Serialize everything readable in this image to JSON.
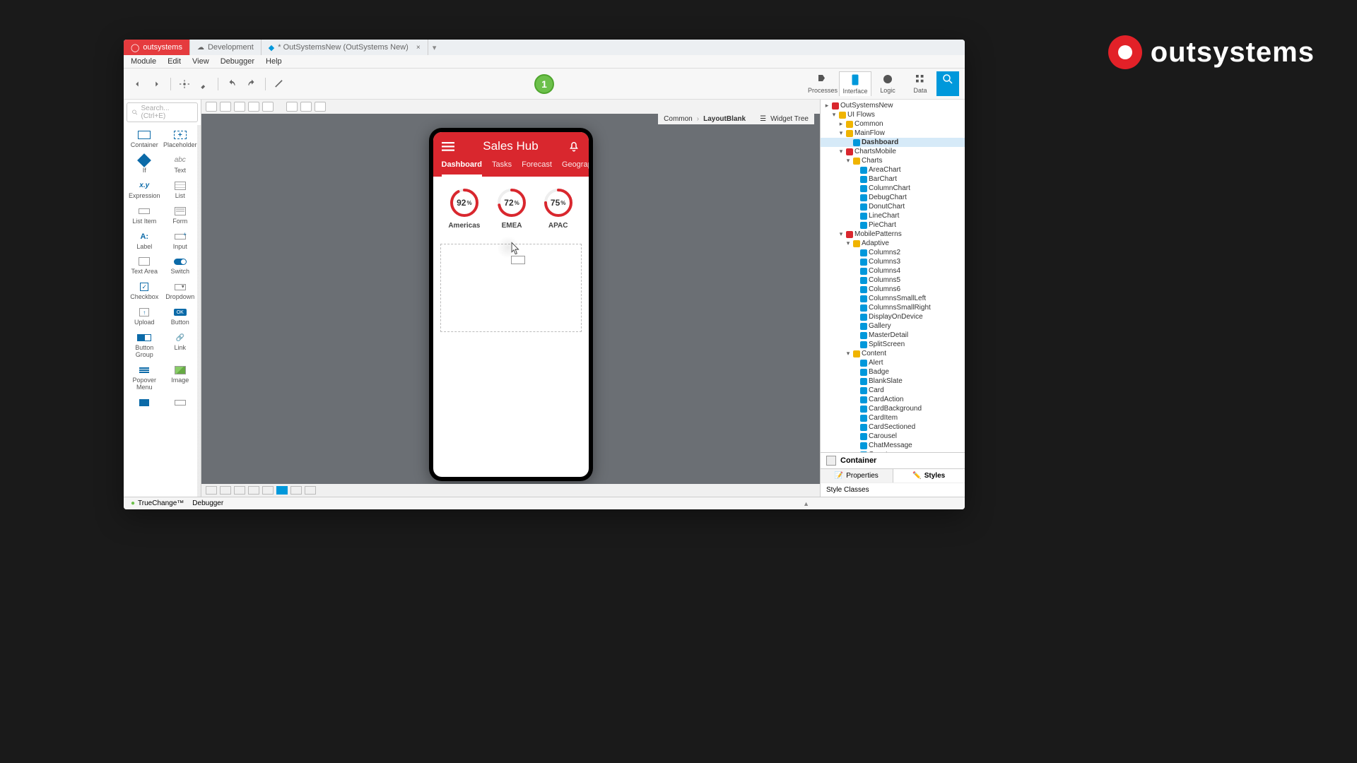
{
  "brand": "outsystems",
  "tabs": {
    "app": "outsystems",
    "env": "Development",
    "module": "* OutSystemsNew (OutSystems New)"
  },
  "menu": {
    "module": "Module",
    "edit": "Edit",
    "view": "View",
    "debugger": "Debugger",
    "help": "Help"
  },
  "publish_badge": "1",
  "right_tools": {
    "processes": "Processes",
    "interface": "Interface",
    "logic": "Logic",
    "data": "Data"
  },
  "search_placeholder": "Search... (Ctrl+E)",
  "widgets": [
    {
      "id": "container",
      "label": "Container",
      "cls": "ico-container"
    },
    {
      "id": "placeholder",
      "label": "Placeholder",
      "cls": "ico-placeholder",
      "inner": "+"
    },
    {
      "id": "if",
      "label": "If",
      "cls": "ico-if"
    },
    {
      "id": "text",
      "label": "Text",
      "cls": "ico-text",
      "inner": "abc"
    },
    {
      "id": "expression",
      "label": "Expression",
      "cls": "ico-expr",
      "inner": "x.y"
    },
    {
      "id": "list",
      "label": "List",
      "cls": "ico-list"
    },
    {
      "id": "listitem",
      "label": "List Item",
      "cls": "ico-listitem"
    },
    {
      "id": "form",
      "label": "Form",
      "cls": "ico-form"
    },
    {
      "id": "label",
      "label": "Label",
      "cls": "ico-label",
      "inner": "A:"
    },
    {
      "id": "input",
      "label": "Input",
      "cls": "ico-input"
    },
    {
      "id": "textarea",
      "label": "Text Area",
      "cls": "ico-textarea"
    },
    {
      "id": "switch",
      "label": "Switch",
      "cls": "ico-switch"
    },
    {
      "id": "checkbox",
      "label": "Checkbox",
      "cls": "ico-checkbox",
      "inner": "✓"
    },
    {
      "id": "dropdown",
      "label": "Dropdown",
      "cls": "ico-dropdown"
    },
    {
      "id": "upload",
      "label": "Upload",
      "cls": "ico-upload",
      "inner": "↑"
    },
    {
      "id": "button",
      "label": "Button",
      "cls": "ico-button",
      "inner": "OK"
    },
    {
      "id": "buttongroup",
      "label": "Button Group",
      "cls": "ico-buttongroup",
      "inner": "<span></span><span></span>"
    },
    {
      "id": "link",
      "label": "Link",
      "cls": "ico-link",
      "inner": "🔗"
    },
    {
      "id": "popovermenu",
      "label": "Popover Menu",
      "cls": "ico-menu",
      "inner": "<span></span><span></span><span></span>"
    },
    {
      "id": "image",
      "label": "Image",
      "cls": "ico-image"
    },
    {
      "id": "flag",
      "label": "",
      "cls": "ico-flag"
    },
    {
      "id": "blank",
      "label": "",
      "cls": "ico-listitem"
    }
  ],
  "breadcrumb": {
    "a": "Common",
    "b": "LayoutBlank"
  },
  "widgettree_label": "Widget Tree",
  "phone": {
    "title": "Sales Hub",
    "tabs": [
      "Dashboard",
      "Tasks",
      "Forecast",
      "Geographies"
    ],
    "gauges": [
      {
        "value": 92,
        "label": "Americas"
      },
      {
        "value": 72,
        "label": "EMEA"
      },
      {
        "value": 75,
        "label": "APAC"
      }
    ]
  },
  "tree": [
    {
      "l": "OutSystemsNew",
      "exp": "▸",
      "ic": "#d9272e",
      "ind": 0
    },
    {
      "l": "UI Flows",
      "exp": "▾",
      "ic": "#f0b400",
      "ind": 1
    },
    {
      "l": "Common",
      "exp": "▸",
      "ic": "#f0b400",
      "ind": 2
    },
    {
      "l": "MainFlow",
      "exp": "▾",
      "ic": "#f0b400",
      "ind": 2
    },
    {
      "l": "Dashboard",
      "exp": "",
      "ic": "#0098db",
      "ind": 3,
      "sel": true
    },
    {
      "l": "ChartsMobile",
      "exp": "▾",
      "ic": "#d9272e",
      "ind": 2
    },
    {
      "l": "Charts",
      "exp": "▾",
      "ic": "#f0b400",
      "ind": 3
    },
    {
      "l": "AreaChart",
      "exp": "",
      "ic": "#0098db",
      "ind": 4
    },
    {
      "l": "BarChart",
      "exp": "",
      "ic": "#0098db",
      "ind": 4
    },
    {
      "l": "ColumnChart",
      "exp": "",
      "ic": "#0098db",
      "ind": 4
    },
    {
      "l": "DebugChart",
      "exp": "",
      "ic": "#0098db",
      "ind": 4
    },
    {
      "l": "DonutChart",
      "exp": "",
      "ic": "#0098db",
      "ind": 4
    },
    {
      "l": "LineChart",
      "exp": "",
      "ic": "#0098db",
      "ind": 4
    },
    {
      "l": "PieChart",
      "exp": "",
      "ic": "#0098db",
      "ind": 4
    },
    {
      "l": "MobilePatterns",
      "exp": "▾",
      "ic": "#d9272e",
      "ind": 2
    },
    {
      "l": "Adaptive",
      "exp": "▾",
      "ic": "#f0b400",
      "ind": 3
    },
    {
      "l": "Columns2",
      "exp": "",
      "ic": "#0098db",
      "ind": 4
    },
    {
      "l": "Columns3",
      "exp": "",
      "ic": "#0098db",
      "ind": 4
    },
    {
      "l": "Columns4",
      "exp": "",
      "ic": "#0098db",
      "ind": 4
    },
    {
      "l": "Columns5",
      "exp": "",
      "ic": "#0098db",
      "ind": 4
    },
    {
      "l": "Columns6",
      "exp": "",
      "ic": "#0098db",
      "ind": 4
    },
    {
      "l": "ColumnsSmallLeft",
      "exp": "",
      "ic": "#0098db",
      "ind": 4
    },
    {
      "l": "ColumnsSmallRight",
      "exp": "",
      "ic": "#0098db",
      "ind": 4
    },
    {
      "l": "DisplayOnDevice",
      "exp": "",
      "ic": "#0098db",
      "ind": 4
    },
    {
      "l": "Gallery",
      "exp": "",
      "ic": "#0098db",
      "ind": 4
    },
    {
      "l": "MasterDetail",
      "exp": "",
      "ic": "#0098db",
      "ind": 4
    },
    {
      "l": "SplitScreen",
      "exp": "",
      "ic": "#0098db",
      "ind": 4
    },
    {
      "l": "Content",
      "exp": "▾",
      "ic": "#f0b400",
      "ind": 3
    },
    {
      "l": "Alert",
      "exp": "",
      "ic": "#0098db",
      "ind": 4
    },
    {
      "l": "Badge",
      "exp": "",
      "ic": "#0098db",
      "ind": 4
    },
    {
      "l": "BlankSlate",
      "exp": "",
      "ic": "#0098db",
      "ind": 4
    },
    {
      "l": "Card",
      "exp": "",
      "ic": "#0098db",
      "ind": 4
    },
    {
      "l": "CardAction",
      "exp": "",
      "ic": "#0098db",
      "ind": 4
    },
    {
      "l": "CardBackground",
      "exp": "",
      "ic": "#0098db",
      "ind": 4
    },
    {
      "l": "CardItem",
      "exp": "",
      "ic": "#0098db",
      "ind": 4
    },
    {
      "l": "CardSectioned",
      "exp": "",
      "ic": "#0098db",
      "ind": 4
    },
    {
      "l": "Carousel",
      "exp": "",
      "ic": "#0098db",
      "ind": 4
    },
    {
      "l": "ChatMessage",
      "exp": "",
      "ic": "#0098db",
      "ind": 4
    },
    {
      "l": "Counter",
      "exp": "",
      "ic": "#0098db",
      "ind": 4
    }
  ],
  "selected_widget": "Container",
  "prop_tabs": {
    "props": "Properties",
    "styles": "Styles"
  },
  "style_classes_label": "Style Classes",
  "status": {
    "truechange": "TrueChange™",
    "debugger": "Debugger"
  }
}
